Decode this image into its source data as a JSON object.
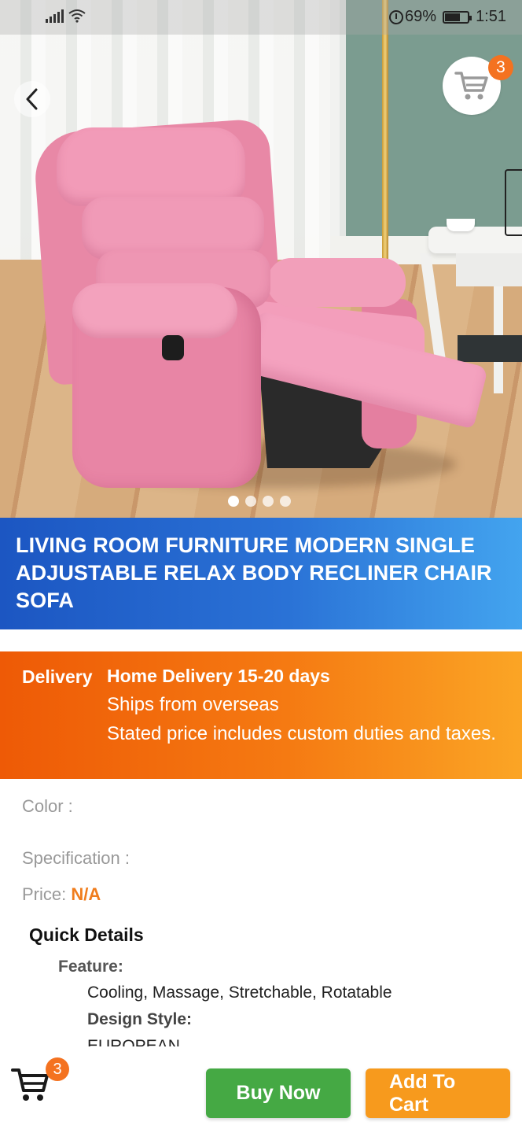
{
  "status_bar": {
    "battery": "69%",
    "time": "1:51"
  },
  "hero": {
    "image_alt": "Pink recliner chair",
    "carousel_dots": 4,
    "active_dot": 0,
    "cart_count": "3"
  },
  "product": {
    "title": "LIVING ROOM FURNITURE MODERN SINGLE ADJUSTABLE RELAX BODY RECLINER CHAIR SOFA"
  },
  "delivery": {
    "label": "Delivery",
    "method": "Home Delivery 15-20 days",
    "ships_from": "Ships from overseas",
    "duties_note": "Stated price includes custom duties and taxes."
  },
  "details": {
    "color_label": "Color :",
    "spec_label": "Specification :",
    "price_label": "Price:",
    "price_value": "N/A",
    "quick_details_title": "Quick Details",
    "feature_label": "Feature:",
    "feature_value": "Cooling, Massage, Stretchable, Rotatable",
    "design_style_label": "Design Style:",
    "design_style_value": "EUROPEAN"
  },
  "bottom_bar": {
    "cart_count": "3",
    "buy_now": "Buy Now",
    "add_to_cart_line1": "Add To",
    "add_to_cart_line2": "Cart"
  },
  "colors": {
    "title_banner": "#1c56c2",
    "delivery_banner": "#ee5a06",
    "buy_now": "#45a944",
    "add_to_cart": "#f79a1d",
    "badge": "#f47220",
    "price_na": "#f07d1d"
  }
}
